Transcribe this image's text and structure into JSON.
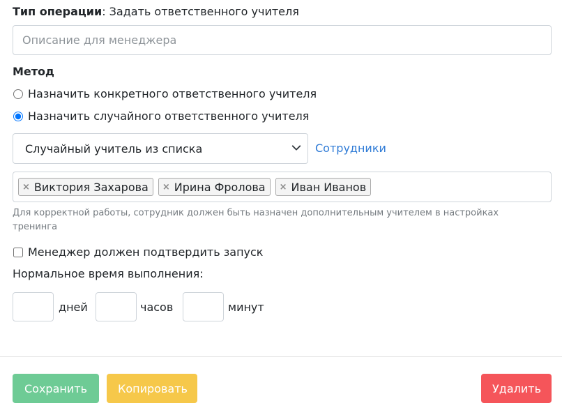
{
  "operation": {
    "type_label": "Тип операции",
    "type_value": ": Задать ответственного учителя"
  },
  "description_input": {
    "value": "",
    "placeholder": "Описание для менеджера"
  },
  "method": {
    "label": "Метод",
    "options": [
      {
        "label": "Назначить конкретного ответственного учителя",
        "selected": false
      },
      {
        "label": "Назначить случайного ответственного учителя",
        "selected": true
      }
    ]
  },
  "teacher_select": {
    "selected": "Случайный учитель из списка",
    "link_label": "Сотрудники"
  },
  "tags": [
    {
      "remove": "×",
      "label": "Виктория Захарова"
    },
    {
      "remove": "×",
      "label": "Ирина Фролова"
    },
    {
      "remove": "×",
      "label": "Иван Иванов"
    }
  ],
  "help_text": "Для корректной работы, сотрудник должен быть назначен дополнительным учителем в настройках тренинга",
  "confirm_checkbox": {
    "label": "Менеджер должен подтвердить запуск",
    "checked": false
  },
  "normal_time": {
    "label": "Нормальное время выполнения:",
    "days_unit": "дней",
    "hours_unit": "часов",
    "minutes_unit": "минут"
  },
  "buttons": {
    "save": "Сохранить",
    "copy": "Копировать",
    "delete": "Удалить"
  },
  "colors": {
    "save": "#6ecb95",
    "copy": "#f6c84a",
    "delete": "#f5555a",
    "link": "#2f7bd6"
  }
}
